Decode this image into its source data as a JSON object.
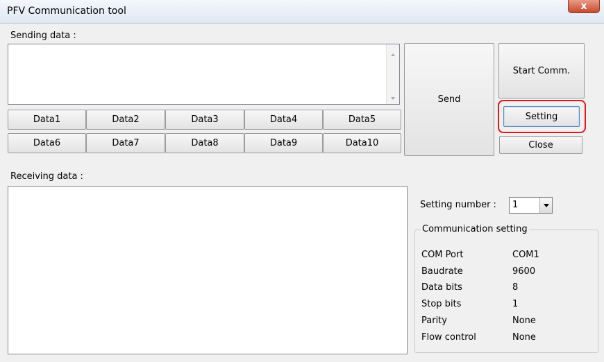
{
  "window": {
    "title": "PFV Communication tool",
    "close_glyph": "x"
  },
  "sending": {
    "label": "Sending data :"
  },
  "data_buttons": [
    "Data1",
    "Data2",
    "Data3",
    "Data4",
    "Data5",
    "Data6",
    "Data7",
    "Data8",
    "Data9",
    "Data10"
  ],
  "buttons": {
    "send": "Send",
    "start_comm": "Start Comm.",
    "setting": "Setting",
    "close": "Close"
  },
  "receiving": {
    "label": "Receiving data :"
  },
  "setting_number": {
    "label": "Setting number :",
    "value": "1"
  },
  "comm_setting": {
    "title": "Communication setting",
    "rows": [
      {
        "key": "COM Port",
        "value": "COM1"
      },
      {
        "key": "Baudrate",
        "value": "9600"
      },
      {
        "key": "Data bits",
        "value": "8"
      },
      {
        "key": "Stop bits",
        "value": "1"
      },
      {
        "key": "Parity",
        "value": "None"
      },
      {
        "key": "Flow control",
        "value": "None"
      }
    ]
  },
  "colors": {
    "highlight": "#e8141c",
    "close_button": "#c64a2e"
  }
}
